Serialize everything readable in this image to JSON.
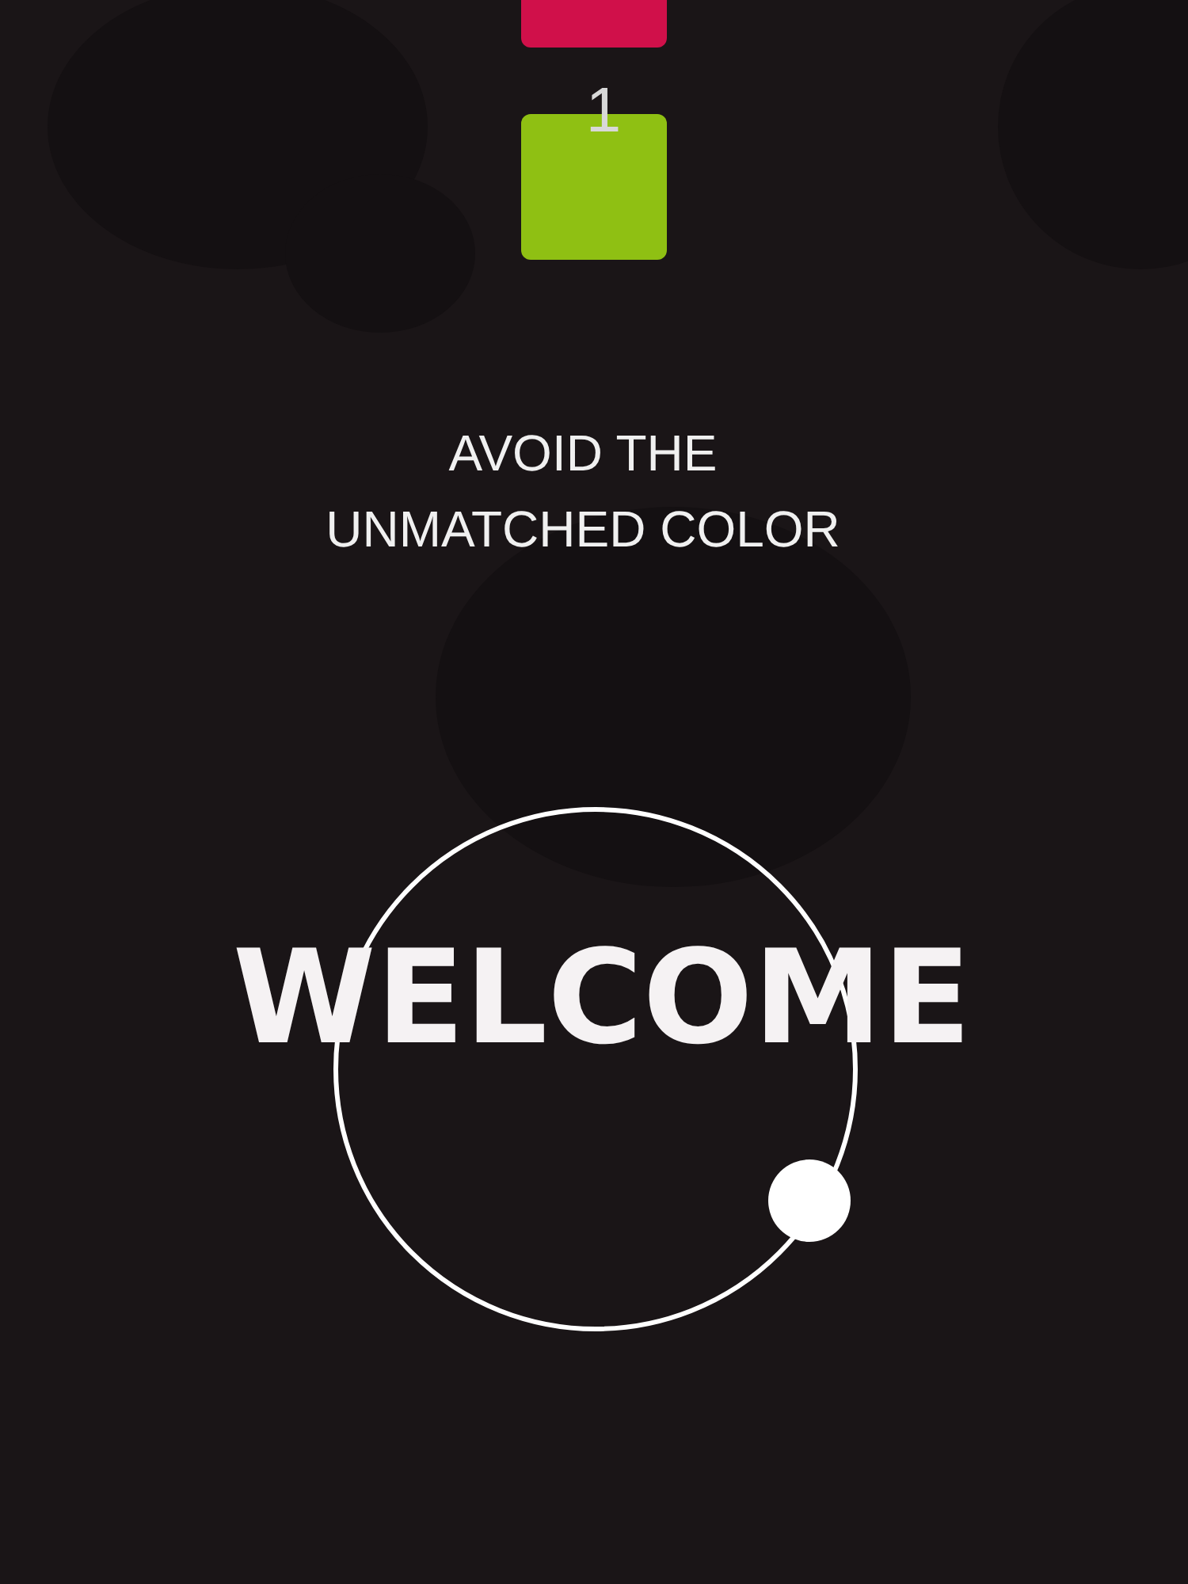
{
  "blocks": [
    {
      "color": "#d0104a"
    },
    {
      "color": "#8fc013"
    }
  ],
  "score": "1",
  "instruction": "AVOID THE UNMATCHED COLOR",
  "title": "WELCOME"
}
